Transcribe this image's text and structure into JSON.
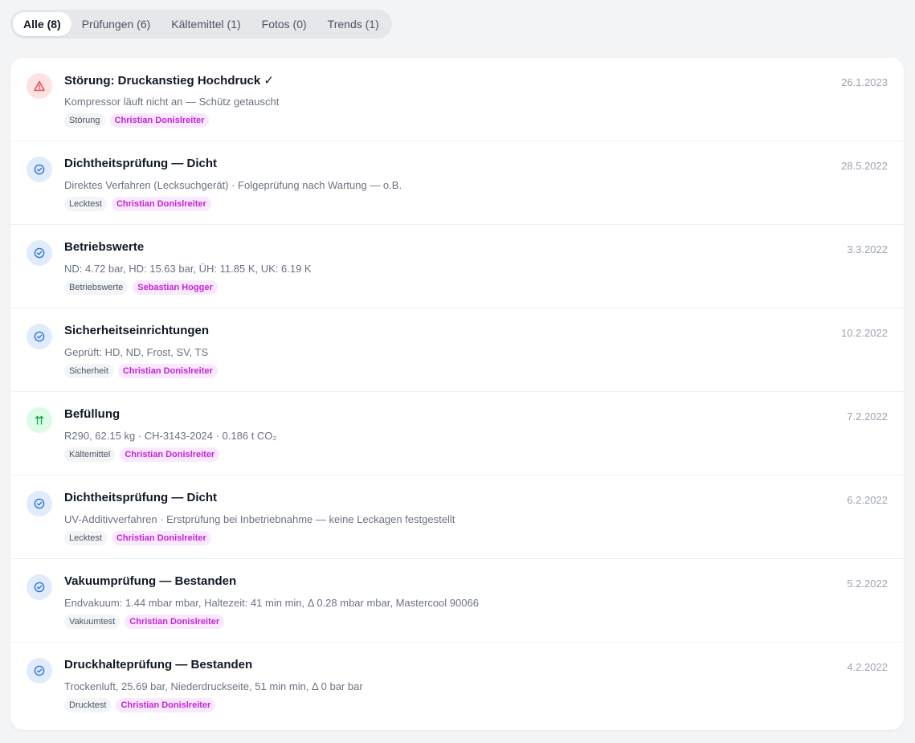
{
  "tabs": [
    {
      "label": "Alle (8)",
      "active": true
    },
    {
      "label": "Prüfungen (6)",
      "active": false
    },
    {
      "label": "Kältemittel (1)",
      "active": false
    },
    {
      "label": "Fotos (0)",
      "active": false
    },
    {
      "label": "Trends (1)",
      "active": false
    }
  ],
  "colors": {
    "warning_bg": "#fee2e2",
    "warning_fg": "#ef4444",
    "check_bg": "#e0ecfb",
    "check_fg": "#2563eb",
    "fill_bg": "#dcfce7",
    "fill_fg": "#16a34a",
    "person_tag_bg": "#fae8ff",
    "person_tag_fg": "#c026d3"
  },
  "entries": [
    {
      "icon": "warning-triangle-icon",
      "title": "Störung: Druckanstieg Hochdruck ✓",
      "date": "26.1.2023",
      "description": "Kompressor läuft nicht an — Schütz getauscht",
      "type_tag": "Störung",
      "person_tag": "Christian Donislreiter"
    },
    {
      "icon": "check-circle-icon",
      "title": "Dichtheitsprüfung — Dicht",
      "date": "28.5.2022",
      "description": "Direktes Verfahren (Lecksuchgerät) · Folgeprüfung nach Wartung — o.B.",
      "type_tag": "Lecktest",
      "person_tag": "Christian Donislreiter"
    },
    {
      "icon": "check-circle-icon",
      "title": "Betriebswerte",
      "date": "3.3.2022",
      "description": "ND: 4.72 bar, HD: 15.63 bar, ÜH: 11.85 K, UK: 6.19 K",
      "type_tag": "Betriebswerte",
      "person_tag": "Sebastian Hogger"
    },
    {
      "icon": "check-circle-icon",
      "title": "Sicherheitseinrichtungen",
      "date": "10.2.2022",
      "description": "Geprüft: HD, ND, Frost, SV, TS",
      "type_tag": "Sicherheit",
      "person_tag": "Christian Donislreiter"
    },
    {
      "icon": "fill-arrows-icon",
      "title": "Befüllung",
      "date": "7.2.2022",
      "description": "R290, 62.15 kg · CH-3143-2024 · 0.186 t CO₂",
      "type_tag": "Kältemittel",
      "person_tag": "Christian Donislreiter"
    },
    {
      "icon": "check-circle-icon",
      "title": "Dichtheitsprüfung — Dicht",
      "date": "6.2.2022",
      "description": "UV-Additivverfahren · Erstprüfung bei Inbetriebnahme — keine Leckagen festgestellt",
      "type_tag": "Lecktest",
      "person_tag": "Christian Donislreiter"
    },
    {
      "icon": "check-circle-icon",
      "title": "Vakuumprüfung — Bestanden",
      "date": "5.2.2022",
      "description": "Endvakuum: 1.44 mbar mbar, Haltezeit: 41 min min, Δ 0.28 mbar mbar, Mastercool 90066",
      "type_tag": "Vakuumtest",
      "person_tag": "Christian Donislreiter"
    },
    {
      "icon": "check-circle-icon",
      "title": "Druckhalteprüfung — Bestanden",
      "date": "4.2.2022",
      "description": "Trockenluft, 25.69 bar, Niederdruckseite, 51 min min, Δ 0 bar bar",
      "type_tag": "Drucktest",
      "person_tag": "Christian Donislreiter"
    }
  ]
}
